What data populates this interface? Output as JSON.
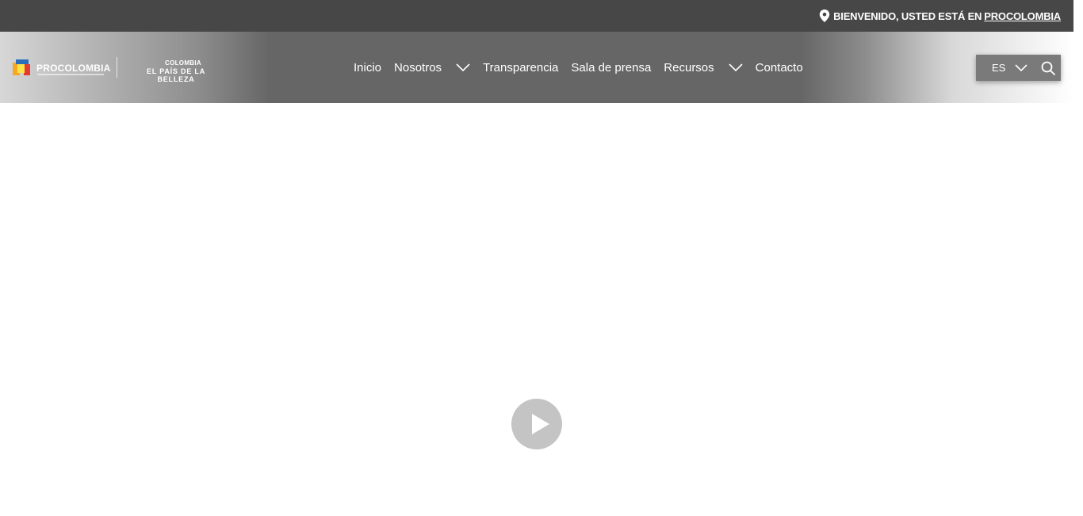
{
  "topbar": {
    "welcome": "BIENVENIDO, USTED ESTÁ EN",
    "site_link": "PROCOLOMBIA",
    "pin_icon": "location-pin-icon"
  },
  "logos": {
    "procolombia": "PROCOLOMBIA",
    "colombia_line1": "COLOMBIA",
    "colombia_line2": "EL PAÍS DE LA BELLEZA",
    "cube_colors": [
      "#f7a823",
      "#2a6ebb",
      "#e53a2f",
      "#fbe34b"
    ]
  },
  "menu": {
    "items": [
      {
        "label": "Inicio"
      },
      {
        "label": "Nosotros"
      },
      {
        "label": "Transparencia"
      },
      {
        "label": "Sala de prensa"
      },
      {
        "label": "Recursos"
      },
      {
        "label": "Contacto"
      }
    ]
  },
  "lang": {
    "selected": "ES",
    "search_icon": "search-icon"
  },
  "video": {
    "play_icon": "play-icon"
  },
  "colors": {
    "topbar_bg": "#474747",
    "nav_bg": "#666666",
    "play_bg": "#c4c4c4"
  }
}
